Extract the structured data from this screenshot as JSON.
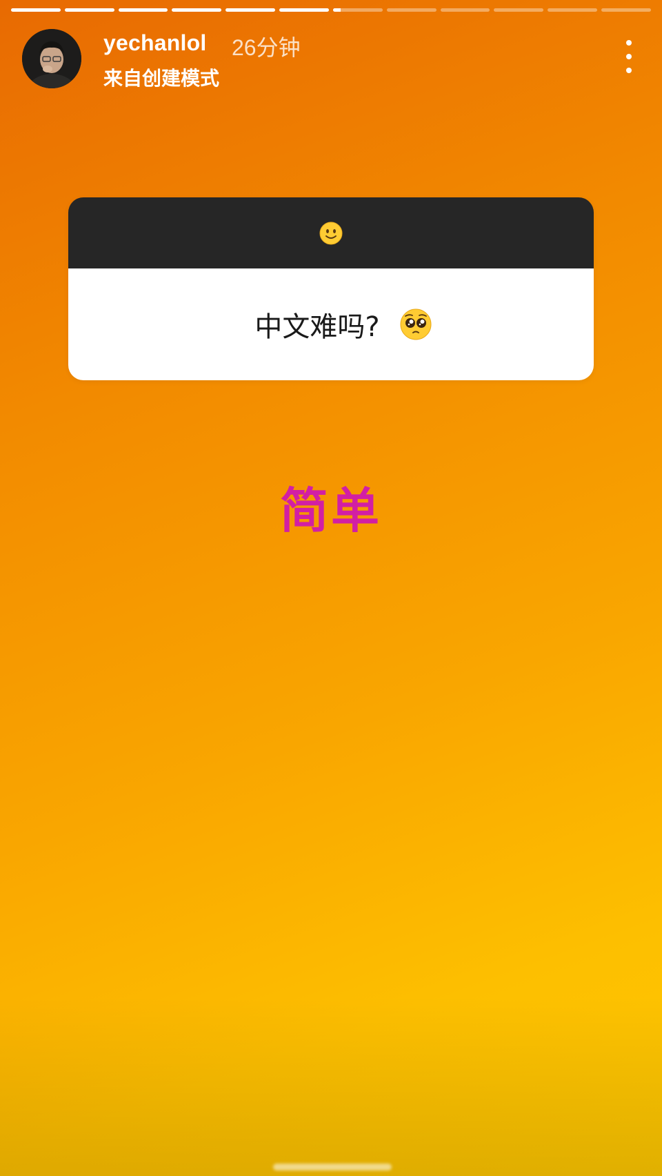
{
  "story": {
    "segments_total": 12,
    "segments_complete": 6,
    "current_segment_progress": 0.15
  },
  "header": {
    "username": "yechanlol",
    "timestamp": "26分钟",
    "subtitle": "来自创建模式",
    "more_icon": "more-vertical-icon"
  },
  "sticker": {
    "top_emoji": "🙂",
    "question": "中文难吗?",
    "question_emoji": "🥺"
  },
  "answer": {
    "text": "简单",
    "color": "#d21fa4"
  },
  "colors": {
    "gradient_start": "#e86a02",
    "gradient_end": "#ffc800",
    "sticker_header": "#262626"
  }
}
